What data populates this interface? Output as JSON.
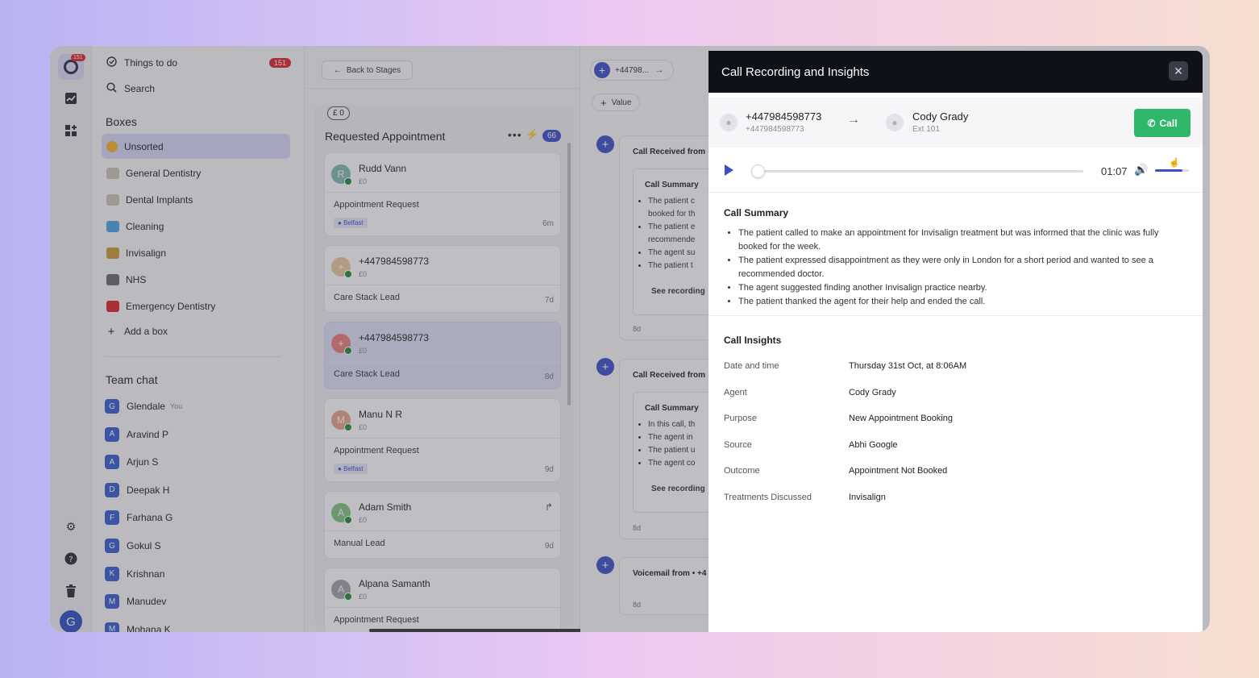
{
  "rail": {
    "notification_count": "151",
    "icons": [
      "chat-logo-icon",
      "chart-icon",
      "widgets-icon",
      "gear-icon",
      "help-icon",
      "trash-icon"
    ],
    "user_initial": "G"
  },
  "sidebar": {
    "things_to_do": "Things to do",
    "things_to_do_count": "151",
    "search": "Search",
    "boxes_heading": "Boxes",
    "boxes": [
      {
        "label": "Unsorted",
        "color": "#f0b429"
      },
      {
        "label": "General Dentistry",
        "color": "#c9c3b5"
      },
      {
        "label": "Dental Implants",
        "color": "#c9c3b5"
      },
      {
        "label": "Cleaning",
        "color": "#4aa3df"
      },
      {
        "label": "Invisalign",
        "color": "#c99a3a"
      },
      {
        "label": "NHS",
        "color": "#6b6b6b"
      },
      {
        "label": "Emergency Dentistry",
        "color": "#d9262c"
      }
    ],
    "add_box": "Add a box",
    "team_chat_heading": "Team chat",
    "you_label": "You",
    "team": [
      {
        "initial": "G",
        "name": "Glendale"
      },
      {
        "initial": "A",
        "name": "Aravind P"
      },
      {
        "initial": "A",
        "name": "Arjun S"
      },
      {
        "initial": "D",
        "name": "Deepak H"
      },
      {
        "initial": "F",
        "name": "Farhana G"
      },
      {
        "initial": "G",
        "name": "Gokul S"
      },
      {
        "initial": "K",
        "name": "Krishnan"
      },
      {
        "initial": "M",
        "name": "Manudev"
      },
      {
        "initial": "M",
        "name": "Mohana K"
      }
    ]
  },
  "column": {
    "back_label": "Back to Stages",
    "value_pill": "£ 0",
    "stage_title": "Requested Appointment",
    "stage_count": "66",
    "cards": [
      {
        "initial": "R",
        "name": "Rudd Vann",
        "value": "£0",
        "type": "Appointment Request",
        "tag": "Belfast",
        "age": "6m",
        "color": "#7fb6b0"
      },
      {
        "initial": "+",
        "name": "+447984598773",
        "value": "£0",
        "type": "Care Stack Lead",
        "tag": "",
        "age": "7d",
        "color": "#e8c79a"
      },
      {
        "initial": "+",
        "name": "+447984598773",
        "value": "£0",
        "type": "Care Stack Lead",
        "tag": "",
        "age": "8d",
        "color": "#e87c7c"
      },
      {
        "initial": "M",
        "name": "Manu N R",
        "value": "£0",
        "type": "Appointment Request",
        "tag": "Belfast",
        "age": "9d",
        "color": "#e8a08a"
      },
      {
        "initial": "A",
        "name": "Adam Smith",
        "value": "£0",
        "type": "Manual Lead",
        "tag": "",
        "age": "9d",
        "color": "#7fbf7f"
      },
      {
        "initial": "A",
        "name": "Alpana Samanth",
        "value": "£0",
        "type": "Appointment Request",
        "tag": "",
        "age": "",
        "color": "#a0a0a8"
      }
    ]
  },
  "timeline": {
    "chip_label": "+44798...",
    "value_label": "Value",
    "entries": [
      {
        "title": "Call Received from",
        "summary": "Call Summary",
        "bullets": [
          "The patient c",
          "booked for th",
          "The patient e",
          "recommende",
          "The agent su",
          "The patient t"
        ],
        "see": "See recording",
        "age": "8d"
      },
      {
        "title": "Call Received from",
        "summary": "Call Summary",
        "bullets": [
          "In this call, th",
          "The agent in",
          "The patient u",
          "The agent co"
        ],
        "see": "See recording",
        "age": "8d"
      },
      {
        "title": "Voicemail from • +4",
        "age": "8d"
      }
    ]
  },
  "modal": {
    "title": "Call Recording and Insights",
    "from_number": "+447984598773",
    "from_sub": "+447984598773",
    "to_name": "Cody Grady",
    "to_sub": "Ext 101",
    "call_label": "Call",
    "elapsed": "01:07",
    "progress": 0.0,
    "volume": 0.8,
    "summary_title": "Call Summary",
    "summary": [
      "The patient called to make an appointment for Invisalign treatment but was informed that the clinic was fully booked for the week.",
      "The patient expressed disappointment as they were only in London for a short period and wanted to see a recommended doctor.",
      "The agent suggested finding another Invisalign practice nearby.",
      "The patient thanked the agent for their help and ended the call."
    ],
    "insights_title": "Call Insights",
    "insights": [
      {
        "key": "Date and time",
        "value": "Thursday 31st Oct, at 8:06AM"
      },
      {
        "key": "Agent",
        "value": "Cody Grady"
      },
      {
        "key": "Purpose",
        "value": "New Appointment Booking"
      },
      {
        "key": "Source",
        "value": "Abhi Google"
      },
      {
        "key": "Outcome",
        "value": "Appointment Not Booked"
      },
      {
        "key": "Treatments Discussed",
        "value": "Invisalign"
      }
    ]
  }
}
